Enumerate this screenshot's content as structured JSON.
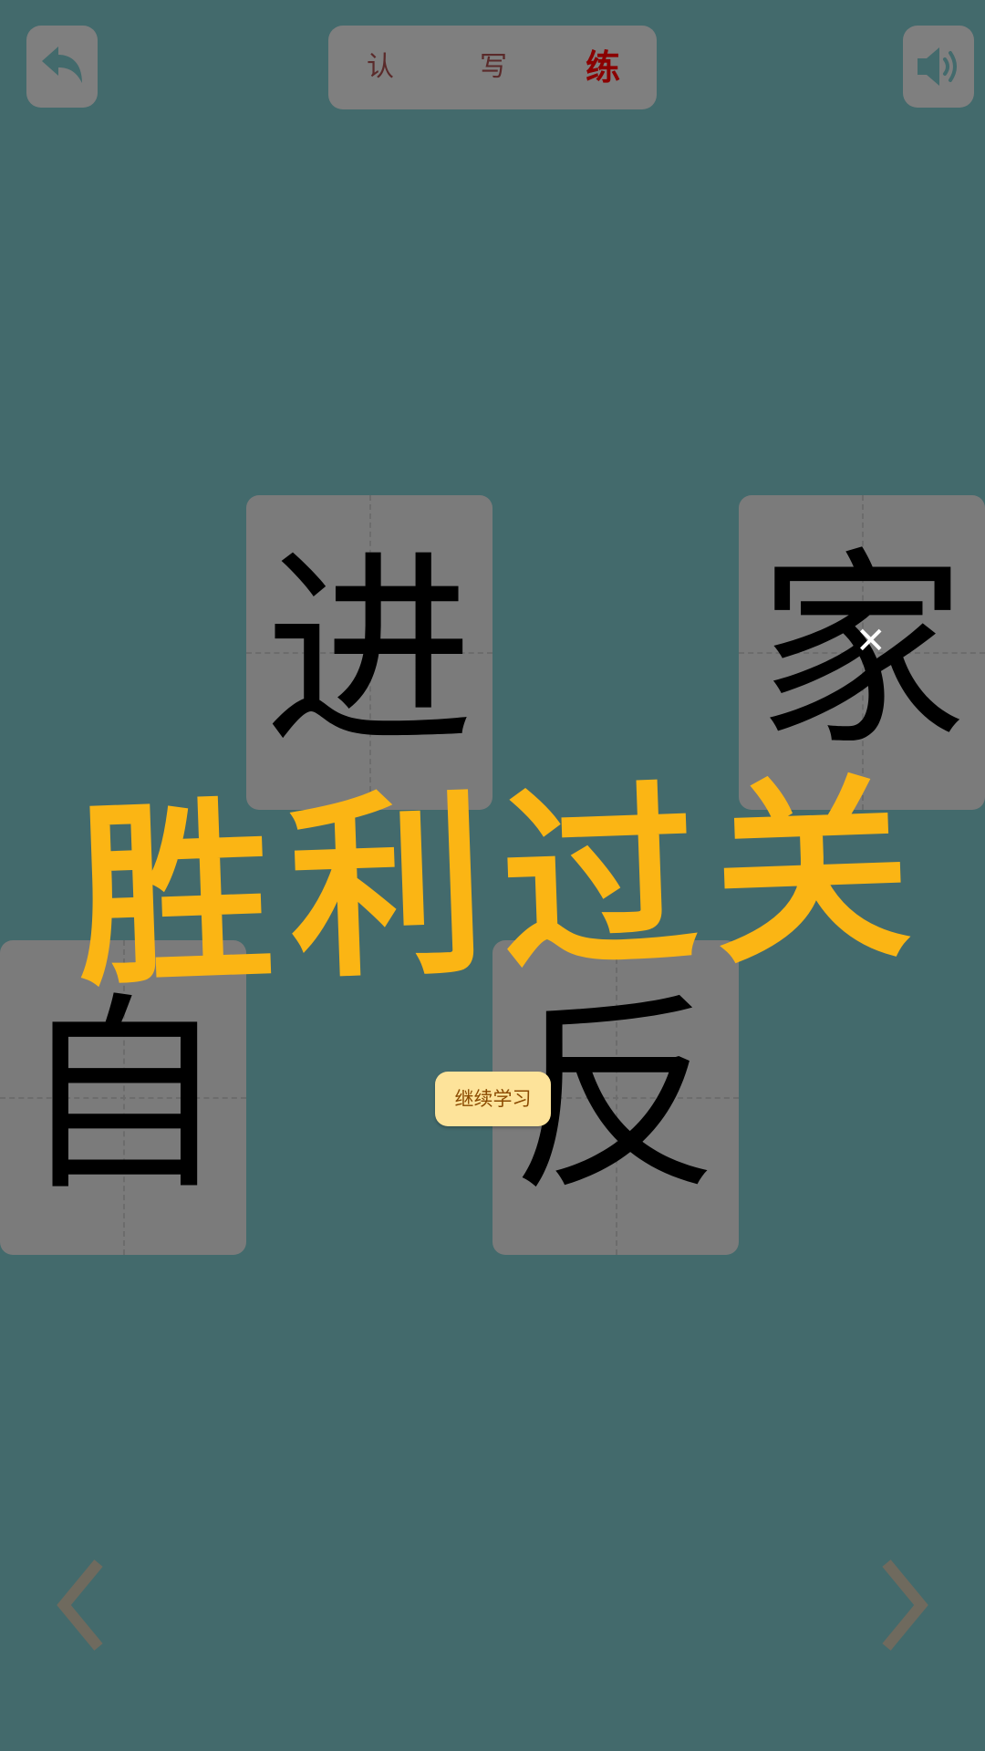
{
  "header": {
    "tabs": [
      {
        "label": "认",
        "active": false
      },
      {
        "label": "写",
        "active": false
      },
      {
        "label": "练",
        "active": true
      }
    ],
    "back_icon": "back-arrow-icon",
    "sound_icon": "speaker-icon"
  },
  "cards": [
    {
      "char": "进"
    },
    {
      "char": "家"
    },
    {
      "char": "自"
    },
    {
      "char": "反"
    }
  ],
  "overlay": {
    "banner": "胜利过关",
    "continue_label": "继续学习",
    "close_symbol": "✕"
  },
  "footer": {
    "prev_icon": "chevron-left-icon",
    "next_icon": "chevron-right-icon"
  },
  "colors": {
    "background": "#436a6c",
    "panel": "#7f7f7f",
    "banner": "#fbb514",
    "button": "#fde39a",
    "active_tab": "#8b0000"
  }
}
